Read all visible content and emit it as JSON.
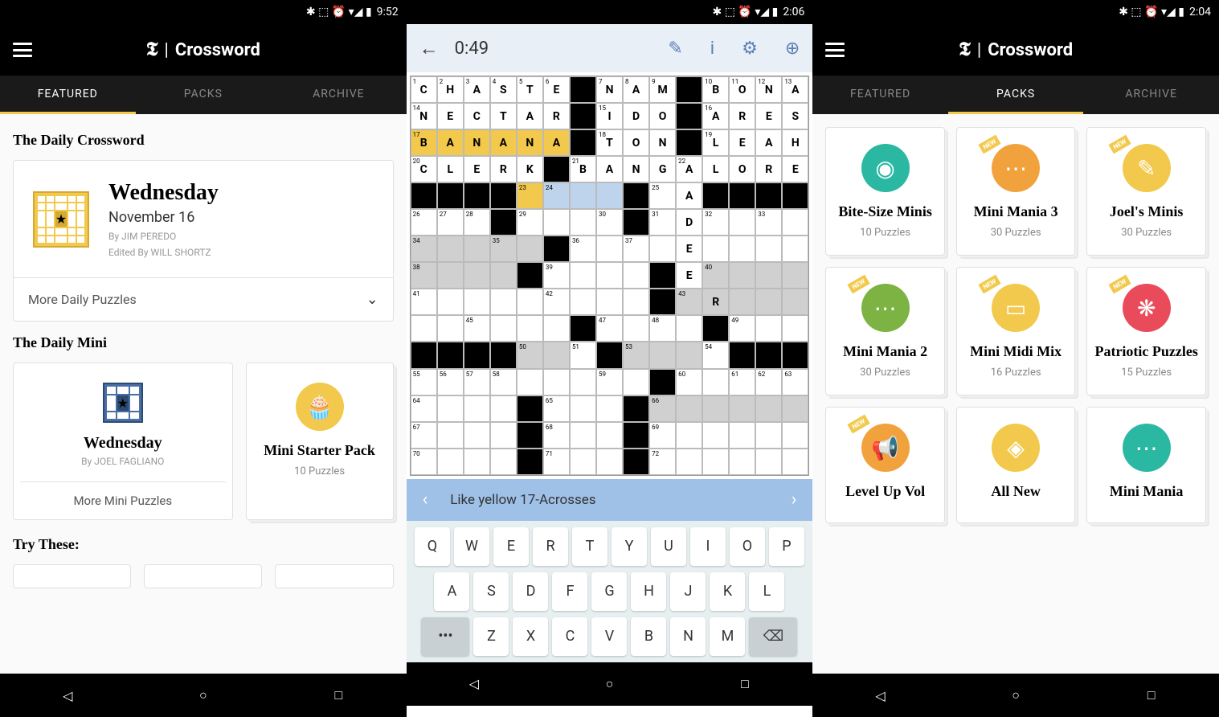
{
  "status": {
    "icons": "✱ ⬚ ⏰ ▾◢ ▮",
    "time1": "9:52",
    "time2": "2:06",
    "time3": "2:04"
  },
  "header": {
    "logo": "𝕿",
    "title": "Crossword"
  },
  "tabs": {
    "featured": "FEATURED",
    "packs": "PACKS",
    "archive": "ARCHIVE"
  },
  "s1": {
    "sec1": "The Daily Crossword",
    "daily": {
      "title": "Wednesday",
      "date": "November 16",
      "by": "By JIM PEREDO",
      "editor": "Edited By WILL SHORTZ"
    },
    "more_daily": "More Daily Puzzles",
    "sec2": "The Daily Mini",
    "mini": {
      "title": "Wednesday",
      "by": "By JOEL FAGLIANO",
      "more": "More Mini Puzzles"
    },
    "starter": {
      "title": "Mini Starter Pack",
      "count": "10 Puzzles"
    },
    "sec3": "Try These:"
  },
  "s2": {
    "timer": "0:49",
    "grid": [
      [
        {
          "n": "1",
          "l": "C"
        },
        {
          "n": "2",
          "l": "H"
        },
        {
          "n": "3",
          "l": "A"
        },
        {
          "n": "4",
          "l": "S"
        },
        {
          "n": "5",
          "l": "T"
        },
        {
          "n": "6",
          "l": "E"
        },
        {
          "b": 1
        },
        {
          "n": "7",
          "l": "N"
        },
        {
          "n": "8",
          "l": "A"
        },
        {
          "n": "9",
          "l": "M"
        },
        {
          "b": 1
        },
        {
          "n": "10",
          "l": "B"
        },
        {
          "n": "11",
          "l": "O"
        },
        {
          "n": "12",
          "l": "N"
        },
        {
          "n": "13",
          "l": "A"
        }
      ],
      [
        {
          "n": "14",
          "l": "N"
        },
        {
          "l": "E"
        },
        {
          "l": "C"
        },
        {
          "l": "T"
        },
        {
          "l": "A"
        },
        {
          "l": "R"
        },
        {
          "b": 1
        },
        {
          "n": "15",
          "l": "I"
        },
        {
          "l": "D"
        },
        {
          "l": "O"
        },
        {
          "b": 1
        },
        {
          "n": "16",
          "l": "A"
        },
        {
          "l": "R"
        },
        {
          "l": "E"
        },
        {
          "l": "S"
        }
      ],
      [
        {
          "n": "17",
          "l": "B",
          "y": 1
        },
        {
          "l": "A",
          "y": 1
        },
        {
          "l": "N",
          "y": 1
        },
        {
          "l": "A",
          "y": 1
        },
        {
          "l": "N",
          "y": 1
        },
        {
          "l": "A",
          "y": 1
        },
        {
          "b": 1
        },
        {
          "n": "18",
          "l": "T"
        },
        {
          "l": "O"
        },
        {
          "l": "N"
        },
        {
          "b": 1
        },
        {
          "n": "19",
          "l": "L"
        },
        {
          "l": "E"
        },
        {
          "l": "A"
        },
        {
          "l": "H"
        }
      ],
      [
        {
          "n": "20",
          "l": "C"
        },
        {
          "l": "L"
        },
        {
          "l": "E"
        },
        {
          "l": "R"
        },
        {
          "l": "K"
        },
        {
          "b": 1
        },
        {
          "n": "21",
          "l": "B"
        },
        {
          "l": "A"
        },
        {
          "l": "N"
        },
        {
          "l": "G"
        },
        {
          "n": "22",
          "l": "A"
        },
        {
          "l": "L"
        },
        {
          "l": "O"
        },
        {
          "l": "R"
        },
        {
          "l": "E"
        }
      ],
      [
        {
          "b": 1
        },
        {
          "b": 1
        },
        {
          "b": 1
        },
        {
          "b": 1
        },
        {
          "n": "23",
          "y": 1
        },
        {
          "n": "24",
          "bl": 1
        },
        {
          "bl": 1
        },
        {
          "bl": 1
        },
        {
          "b": 1
        },
        {
          "n": "25"
        },
        {
          "l": "A"
        },
        {
          "b": 1
        },
        {
          "b": 1
        },
        {
          "b": 1
        },
        {
          "b": 1
        }
      ],
      [
        {
          "n": "26"
        },
        {
          "n": "27"
        },
        {
          "n": "28"
        },
        {
          "b": 1
        },
        {
          "n": "29"
        },
        {},
        {},
        {
          "n": "30"
        },
        {
          "b": 1
        },
        {
          "n": "31"
        },
        {
          "l": "D"
        },
        {
          "n": "32"
        },
        {},
        {
          "n": "33"
        },
        {}
      ],
      [
        {
          "n": "34",
          "g": 1
        },
        {
          "g": 1
        },
        {
          "g": 1
        },
        {
          "n": "35",
          "g": 1
        },
        {
          "g": 1
        },
        {
          "b": 1
        },
        {
          "n": "36"
        },
        {},
        {
          "n": "37"
        },
        {},
        {
          "l": "E"
        },
        {},
        {},
        {},
        {}
      ],
      [
        {
          "n": "38",
          "g": 1
        },
        {
          "g": 1
        },
        {
          "g": 1
        },
        {
          "g": 1
        },
        {
          "b": 1
        },
        {
          "n": "39"
        },
        {},
        {},
        {},
        {
          "b": 1
        },
        {
          "l": "E"
        },
        {
          "n": "40",
          "g": 1
        },
        {
          "g": 1
        },
        {
          "g": 1
        },
        {
          "g": 1
        }
      ],
      [
        {
          "n": "41"
        },
        {},
        {},
        {},
        {},
        {
          "n": "42"
        },
        {},
        {},
        {},
        {
          "b": 1
        },
        {
          "n": "43",
          "g": 1
        },
        {
          "l": "R",
          "g": 1
        },
        {
          "g": 1
        },
        {
          "g": 1
        },
        {
          "g": 1
        }
      ],
      [
        {},
        {},
        {
          "n": "45"
        },
        {},
        {},
        {},
        {
          "b": 1
        },
        {
          "n": "47"
        },
        {},
        {
          "n": "48"
        },
        {},
        {
          "b": 1
        },
        {
          "n": "49"
        },
        {},
        {}
      ],
      [
        {
          "b": 1
        },
        {
          "b": 1
        },
        {
          "b": 1
        },
        {
          "b": 1
        },
        {
          "n": "50",
          "g": 1
        },
        {
          "g": 1
        },
        {
          "n": "51"
        },
        {
          "b": 1
        },
        {
          "n": "53",
          "g": 1
        },
        {
          "g": 1
        },
        {
          "g": 1
        },
        {
          "n": "54"
        },
        {
          "b": 1
        },
        {
          "b": 1
        },
        {
          "b": 1
        }
      ],
      [
        {
          "n": "55"
        },
        {
          "n": "56"
        },
        {
          "n": "57"
        },
        {
          "n": "58"
        },
        {},
        {},
        {},
        {
          "n": "59"
        },
        {},
        {
          "b": 1
        },
        {
          "n": "60"
        },
        {},
        {
          "n": "61"
        },
        {
          "n": "62"
        },
        {
          "n": "63"
        }
      ],
      [
        {
          "n": "64"
        },
        {},
        {},
        {},
        {
          "b": 1
        },
        {
          "n": "65"
        },
        {},
        {},
        {
          "b": 1
        },
        {
          "n": "66",
          "g": 1
        },
        {
          "g": 1
        },
        {
          "g": 1
        },
        {
          "g": 1
        },
        {
          "g": 1
        },
        {
          "g": 1
        }
      ],
      [
        {
          "n": "67"
        },
        {},
        {},
        {},
        {
          "b": 1
        },
        {
          "n": "68"
        },
        {},
        {},
        {
          "b": 1
        },
        {
          "n": "69"
        },
        {},
        {},
        {},
        {},
        {}
      ],
      [
        {
          "n": "70"
        },
        {},
        {},
        {},
        {
          "b": 1
        },
        {
          "n": "71"
        },
        {},
        {},
        {
          "b": 1
        },
        {
          "n": "72"
        },
        {},
        {},
        {},
        {},
        {}
      ]
    ],
    "clue": "Like yellow 17-Acrosses",
    "keys": [
      [
        "Q",
        "W",
        "E",
        "R",
        "T",
        "Y",
        "U",
        "I",
        "O",
        "P"
      ],
      [
        "A",
        "S",
        "D",
        "F",
        "G",
        "H",
        "J",
        "K",
        "L"
      ],
      [
        "•••",
        "Z",
        "X",
        "C",
        "V",
        "B",
        "N",
        "M",
        "⌫"
      ]
    ]
  },
  "s3": {
    "packs": [
      {
        "title": "Bite-Size Minis",
        "count": "10 Puzzles",
        "color": "c-teal",
        "icon": "◉",
        "new": 0
      },
      {
        "title": "Mini Mania 3",
        "count": "30 Puzzles",
        "color": "c-orange",
        "icon": "⋯",
        "new": 1
      },
      {
        "title": "Joel's Minis",
        "count": "30 Puzzles",
        "color": "c-yellow",
        "icon": "✎",
        "new": 1
      },
      {
        "title": "Mini Mania 2",
        "count": "30 Puzzles",
        "color": "c-green",
        "icon": "⋯",
        "new": 1
      },
      {
        "title": "Mini Midi Mix",
        "count": "16 Puzzles",
        "color": "c-yellow",
        "icon": "▭",
        "new": 1
      },
      {
        "title": "Patriotic Puzzles",
        "count": "15 Puzzles",
        "color": "c-red",
        "icon": "❋",
        "new": 1
      },
      {
        "title": "Level Up Vol",
        "count": "",
        "color": "c-orange",
        "icon": "📢",
        "new": 1
      },
      {
        "title": "All New",
        "count": "",
        "color": "c-yellow",
        "icon": "◈",
        "new": 0
      },
      {
        "title": "Mini Mania",
        "count": "",
        "color": "c-teal",
        "icon": "⋯",
        "new": 0
      }
    ]
  }
}
